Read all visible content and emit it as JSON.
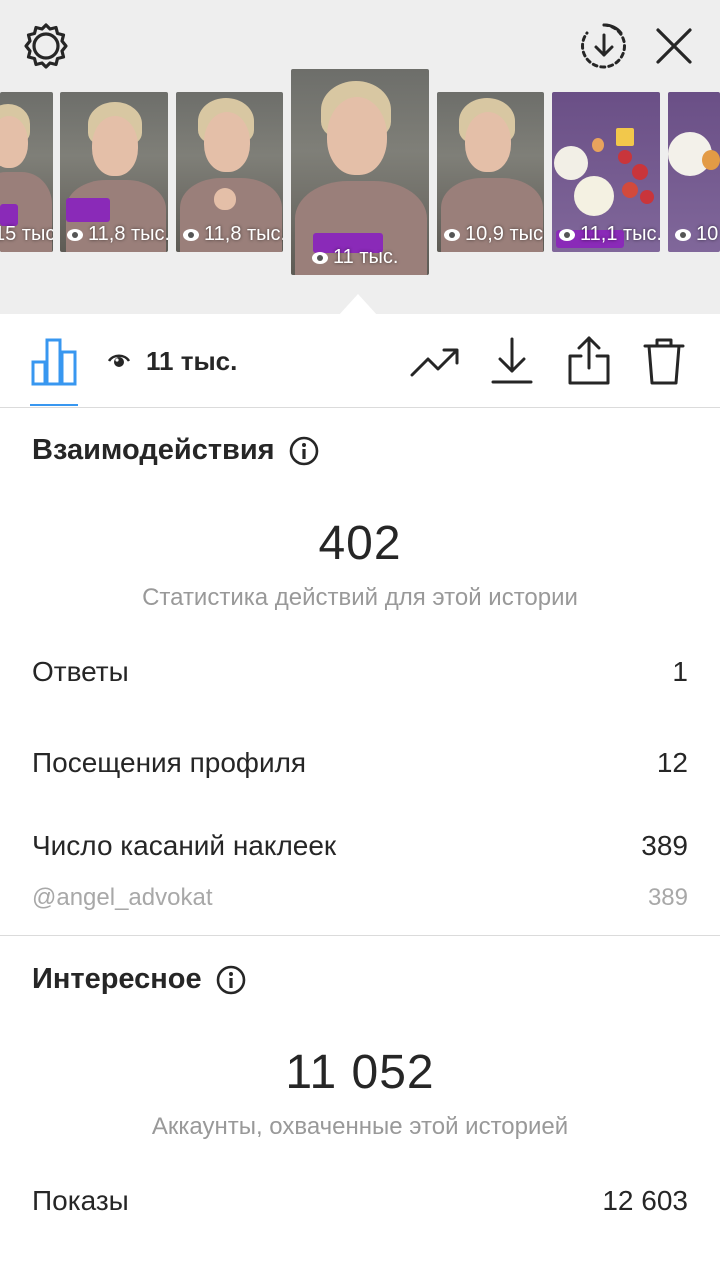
{
  "stories": [
    {
      "views": "15 тыс."
    },
    {
      "views": "11,8 тыс."
    },
    {
      "views": "11,8 тыс."
    },
    {
      "views": "11 тыс.",
      "selected": true
    },
    {
      "views": "10,9 тыс."
    },
    {
      "views": "11,1 тыс."
    },
    {
      "views": "10"
    }
  ],
  "toolbar": {
    "views": "11 тыс."
  },
  "interactions": {
    "title": "Взаимодействия",
    "total": "402",
    "caption": "Статистика действий для этой истории",
    "rows": [
      {
        "label": "Ответы",
        "value": "1"
      },
      {
        "label": "Посещения профиля",
        "value": "12"
      },
      {
        "label": "Число касаний наклеек",
        "value": "389"
      }
    ],
    "sticker_row": {
      "label": "@angel_advokat",
      "value": "389"
    }
  },
  "discovery": {
    "title": "Интересное",
    "total": "11 052",
    "caption": "Аккаунты, охваченные этой историей",
    "rows": [
      {
        "label": "Показы",
        "value": "12 603"
      }
    ]
  },
  "colors": {
    "accent": "#3897f0",
    "text": "#262626",
    "muted": "#999999",
    "divider": "#dbdbdb",
    "sticker": "#8a2ab8"
  },
  "icons": {
    "settings": "gear-icon",
    "archive": "download-circle-icon",
    "close": "close-icon",
    "stats": "bar-chart-icon",
    "eye": "eye-icon",
    "promote": "trending-up-icon",
    "download": "download-icon",
    "share": "share-icon",
    "delete": "trash-icon",
    "info": "info-icon"
  }
}
